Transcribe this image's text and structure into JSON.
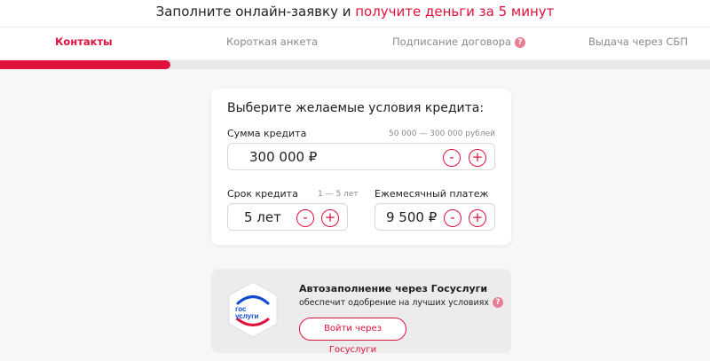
{
  "top_banner": {
    "text_main": "Заполните онлайн-заявку и ",
    "text_accent": "получите деньги за 5 минут"
  },
  "steps": [
    {
      "label": "Контакты",
      "active": true
    },
    {
      "label": "Короткая анкета",
      "active": false
    },
    {
      "label": "Подписание договора",
      "active": false,
      "help": "?"
    },
    {
      "label": "Выдача через СБП",
      "active": false
    }
  ],
  "progress": {
    "fraction": 0.24
  },
  "credit_form": {
    "title": "Выберите желаемые условия кредита:",
    "amount": {
      "label": "Сумма кредита",
      "range": "50 000 — 300 000 рублей",
      "value": "300 000  ₽",
      "minus": "-",
      "plus": "+"
    },
    "term": {
      "label": "Срок кредита",
      "range": "1 — 5 лет",
      "value": "5  лет",
      "minus": "-",
      "plus": "+"
    },
    "payment": {
      "label": "Ежемесячный платеж",
      "value": "9 500  ₽",
      "minus": "-",
      "plus": "+"
    }
  },
  "gosuslugi": {
    "logo_line1": "гос",
    "logo_line2": "услуги",
    "title": "Автозаполнение через Госуслуги",
    "subtitle": "обеспечит одобрение на лучших условиях",
    "help": "?",
    "button": "Войти через Госуслуги"
  },
  "colors": {
    "accent": "#e0113b",
    "gos_blue": "#0d4cd3"
  }
}
